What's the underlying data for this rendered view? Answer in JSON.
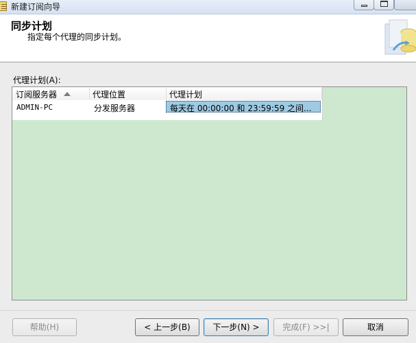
{
  "window": {
    "title": "新建订阅向导"
  },
  "header": {
    "title": "同步计划",
    "subtitle": "指定每个代理的同步计划。"
  },
  "main": {
    "section_label": "代理计划(A):",
    "columns": [
      "订阅服务器",
      "代理位置",
      "代理计划"
    ],
    "rows": [
      {
        "subscriber": "ADMIN-PC",
        "agent_location": "分发服务器",
        "agent_schedule": "每天在 00:00:00 和 23:59:59 之间..."
      }
    ]
  },
  "footer": {
    "help_label": "帮助(H)",
    "back_label": "< 上一步(B)",
    "next_label": "下一步(N) >",
    "finish_label": "完成(F) >>|",
    "cancel_label": "取消"
  },
  "colors": {
    "grid_background": "#cde8cf",
    "selected_cell": "#9ecbe3",
    "titlebar": "#dce6f3"
  },
  "icons": {
    "app": "wizard-icon",
    "header": "sync-database-graphic",
    "sort": "sort-ascending-icon"
  }
}
